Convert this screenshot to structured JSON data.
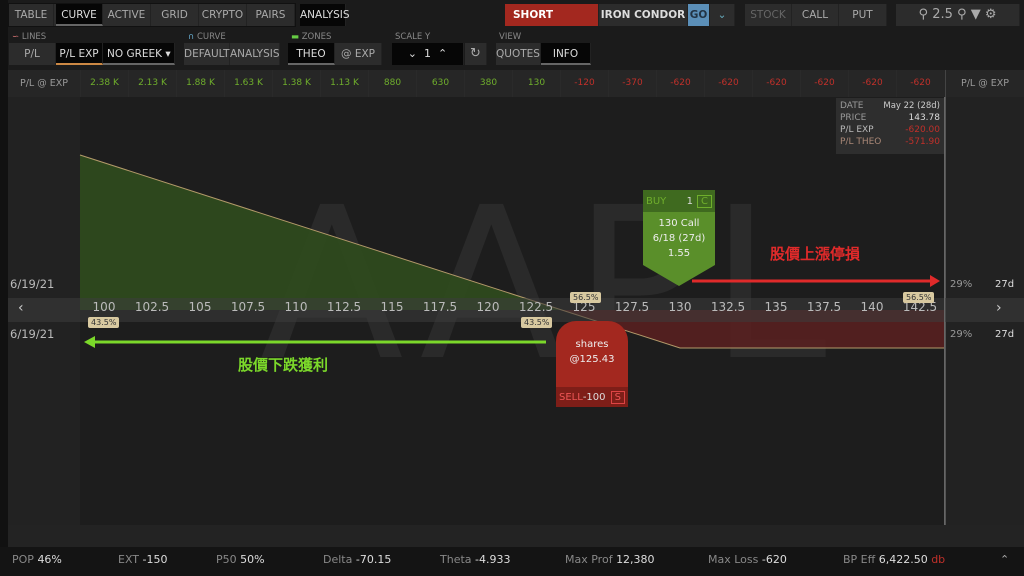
{
  "tabs": [
    "TABLE",
    "CURVE",
    "ACTIVE",
    "GRID",
    "CRYPTO",
    "PAIRS"
  ],
  "analysis_tab": "ANALYSIS",
  "order": {
    "side": "SHORT",
    "strategy": "IRON CONDOR",
    "go": "GO"
  },
  "instruments": [
    "STOCK",
    "CALL",
    "PUT"
  ],
  "zoom": "2.5",
  "lines": {
    "label": "LINES",
    "items": [
      "P/L THEO",
      "P/L EXP"
    ],
    "greek": "NO GREEK"
  },
  "curve": {
    "label": "CURVE",
    "items": [
      "DEFAULT",
      "ANALYSIS"
    ]
  },
  "zones": {
    "label": "ZONES",
    "items": [
      "THEO",
      "@ EXP"
    ]
  },
  "scale": {
    "label": "SCALE Y",
    "value": "1"
  },
  "view": {
    "label": "VIEW",
    "items": [
      "QUOTES",
      "INFO"
    ]
  },
  "pl_row": {
    "label": "P/L @ EXP",
    "values": [
      "2.38 K",
      "2.13 K",
      "1.88 K",
      "1.63 K",
      "1.38 K",
      "1.13 K",
      "880",
      "630",
      "380",
      "130",
      "-120",
      "-370",
      "-620",
      "-620",
      "-620",
      "-620",
      "-620",
      "-620"
    ]
  },
  "info": {
    "date_label": "DATE",
    "date": "May 22 (28d)",
    "price_label": "PRICE",
    "price": "143.78",
    "plexp_label": "P/L EXP",
    "plexp": "-620.00",
    "pltheo_label": "P/L THEO",
    "pltheo": "-571.90"
  },
  "watermark": "AAPL",
  "strikes": [
    "100",
    "102.5",
    "105",
    "107.5",
    "110",
    "112.5",
    "115",
    "117.5",
    "120",
    "122.5",
    "125",
    "127.5",
    "130",
    "132.5",
    "135",
    "137.5",
    "140",
    "142.5"
  ],
  "dates": {
    "top": "6/19/21",
    "bottom": "6/19/21",
    "top_pct": "29%",
    "top_days": "27d",
    "bottom_pct": "29%",
    "bottom_days": "27d"
  },
  "tags": {
    "a": "43.5%",
    "b": "43.5%",
    "c": "56.5%",
    "d": "56.5%"
  },
  "buy": {
    "side": "BUY",
    "qty": "1",
    "type": "C",
    "line1": "130 Call",
    "line2": "6/18 (27d)",
    "line3": "1.55"
  },
  "sell": {
    "line1": "shares",
    "line2": "@125.43",
    "side": "SELL",
    "qty": "-100",
    "type": "S"
  },
  "annotations": {
    "up": "股價上漲停損",
    "down": "股價下跌獲利"
  },
  "stats": [
    {
      "k": "POP",
      "v": "46%"
    },
    {
      "k": "EXT",
      "v": "-150"
    },
    {
      "k": "P50",
      "v": "50%"
    },
    {
      "k": "Delta",
      "v": "-70.15"
    },
    {
      "k": "Theta",
      "v": "-4.933"
    },
    {
      "k": "Max Prof",
      "v": "12,380"
    },
    {
      "k": "Max Loss",
      "v": "-620"
    },
    {
      "k": "BP Eff",
      "v": "6,422.50",
      "u": "db"
    }
  ],
  "colors": {
    "short": "#a3281f",
    "go": "#5b8fb8",
    "profit": "#6fae2c",
    "loss": "#c0302a"
  }
}
